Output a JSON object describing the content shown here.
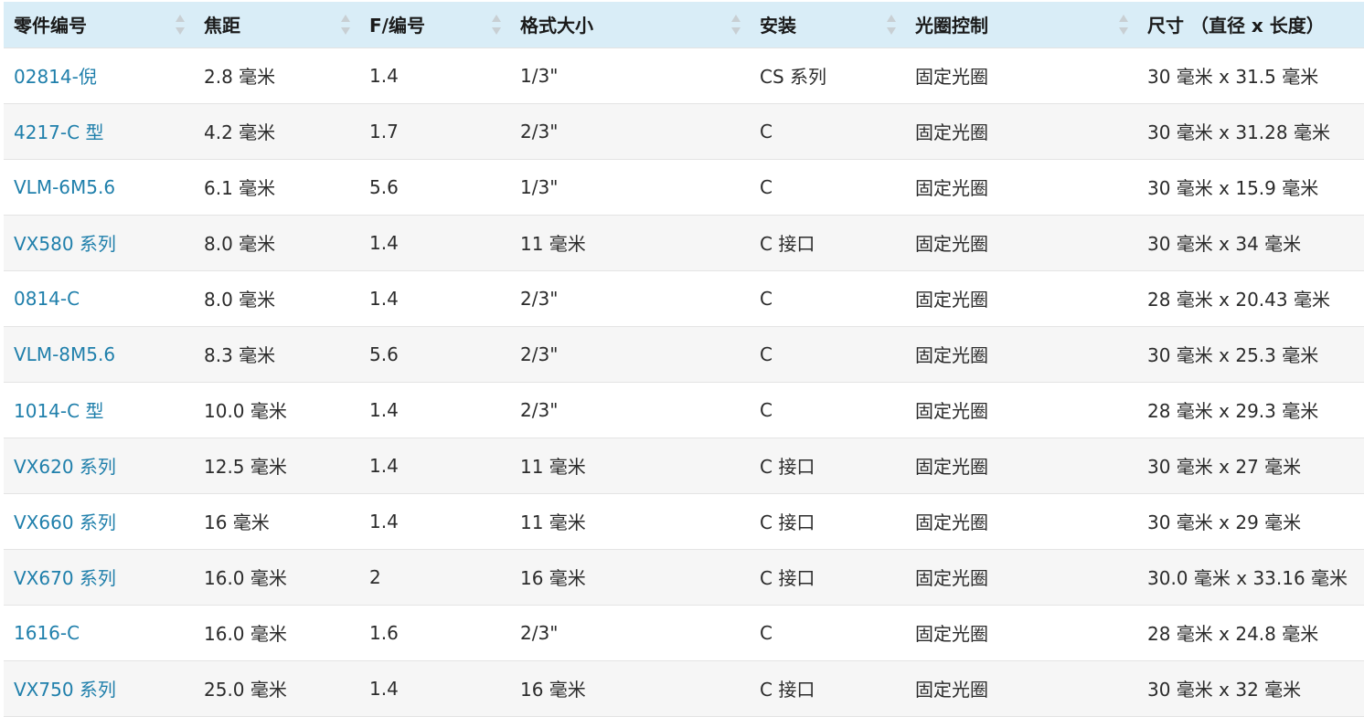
{
  "table": {
    "columns": [
      {
        "label": "零件编号",
        "sortable": true
      },
      {
        "label": "焦距",
        "sortable": true
      },
      {
        "label": "F/编号",
        "sortable": true
      },
      {
        "label": "格式大小",
        "sortable": true
      },
      {
        "label": "安装",
        "sortable": true
      },
      {
        "label": "光圈控制",
        "sortable": true
      },
      {
        "label": "尺寸 （直径 x 长度）",
        "sortable": false
      }
    ],
    "rows": [
      [
        "02814-倪",
        "2.8 毫米",
        "1.4",
        "1/3\"",
        "CS 系列",
        "固定光圈",
        "30 毫米 x 31.5 毫米"
      ],
      [
        "4217-C 型",
        "4.2 毫米",
        "1.7",
        "2/3\"",
        "C",
        "固定光圈",
        "30 毫米 x 31.28 毫米"
      ],
      [
        "VLM-6M5.6",
        "6.1 毫米",
        "5.6",
        "1/3\"",
        "C",
        "固定光圈",
        "30 毫米 x 15.9 毫米"
      ],
      [
        "VX580 系列",
        "8.0 毫米",
        "1.4",
        "11 毫米",
        "C 接口",
        "固定光圈",
        "30 毫米 x 34 毫米"
      ],
      [
        "0814-C",
        "8.0 毫米",
        "1.4",
        "2/3\"",
        "C",
        "固定光圈",
        "28 毫米 x 20.43 毫米"
      ],
      [
        "VLM-8M5.6",
        "8.3 毫米",
        "5.6",
        "2/3\"",
        "C",
        "固定光圈",
        "30 毫米 x 25.3 毫米"
      ],
      [
        "1014-C 型",
        "10.0 毫米",
        "1.4",
        "2/3\"",
        "C",
        "固定光圈",
        "28 毫米 x 29.3 毫米"
      ],
      [
        "VX620 系列",
        "12.5 毫米",
        "1.4",
        "11 毫米",
        "C 接口",
        "固定光圈",
        "30 毫米 x 27 毫米"
      ],
      [
        "VX660 系列",
        "16 毫米",
        "1.4",
        "11 毫米",
        "C 接口",
        "固定光圈",
        "30 毫米 x 29 毫米"
      ],
      [
        "VX670 系列",
        "16.0 毫米",
        "2",
        "16 毫米",
        "C 接口",
        "固定光圈",
        "30.0 毫米 x 33.16 毫米"
      ],
      [
        "1616-C",
        "16.0 毫米",
        "1.6",
        "2/3\"",
        "C",
        "固定光圈",
        "28 毫米 x 24.8 毫米"
      ],
      [
        "VX750 系列",
        "25.0 毫米",
        "1.4",
        "16 毫米",
        "C 接口",
        "固定光圈",
        "30 毫米 x 32 毫米"
      ]
    ]
  },
  "icons": {
    "sort": "sort-arrows-icon"
  },
  "colors": {
    "header_bg": "#d9edf7",
    "link": "#1f7fab",
    "row_alt": "#f6f6f6",
    "sort_arrow": "#c8cfd3"
  }
}
